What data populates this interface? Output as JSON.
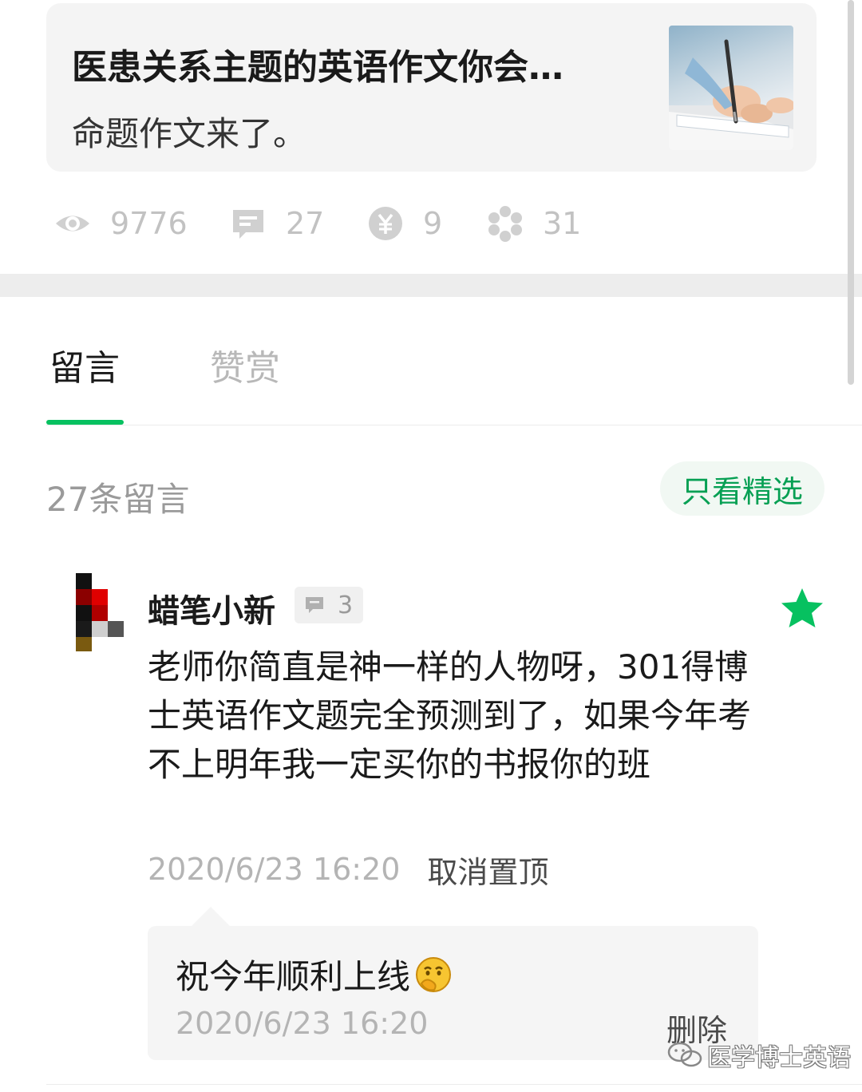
{
  "article": {
    "title": "医患关系主题的英语作文你会…",
    "subtitle": "命题作文来了。",
    "thumbnail_icon": "writing-hand-photo"
  },
  "stats": {
    "views": "9776",
    "comments": "27",
    "rewards": "9",
    "likes": "31"
  },
  "tabs": {
    "comments_label": "留言",
    "rewards_label": "赞赏"
  },
  "comments_section": {
    "count_label": "27条留言",
    "featured_only_label": "只看精选"
  },
  "comment": {
    "username": "蜡笔小新",
    "reply_count": "3",
    "text": "老师你简直是神一样的人物呀，301得博士英语作文题完全预测到了，如果今年考不上明年我一定买你的书报你的班",
    "time": "2020/6/23 16:20",
    "unpin_label": "取消置顶",
    "starred": true
  },
  "reply": {
    "text": "祝今年顺利上线",
    "emoji": "thinking-face-emoji",
    "time": "2020/6/23 16:20",
    "delete_label": "删除"
  },
  "watermark": {
    "text": "医学博士英语"
  },
  "colors": {
    "accent_green": "#07c160",
    "muted_gray": "#c2c2c2",
    "card_bg": "#f4f4f4"
  }
}
